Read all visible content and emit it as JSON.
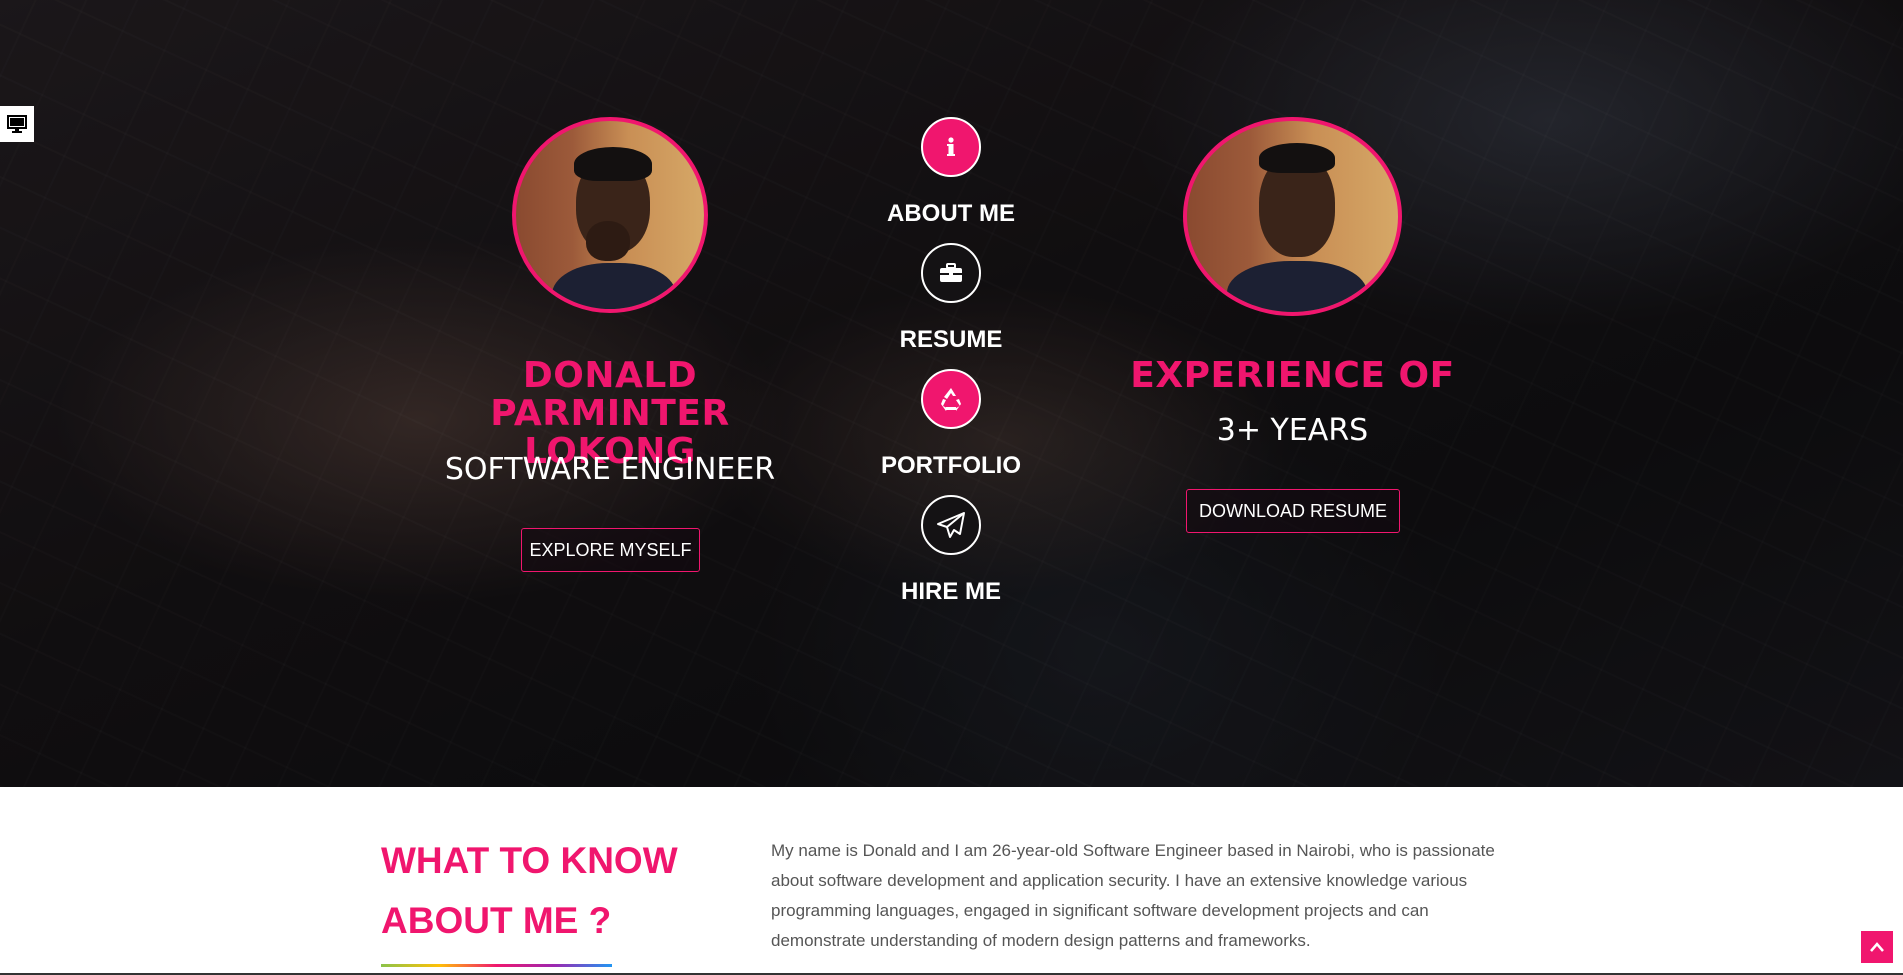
{
  "hero": {
    "name": "DONALD PARMINTER LOKONG",
    "role": "SOFTWARE ENGINEER",
    "explore_label": "EXPLORE MYSELF",
    "experience_title": "EXPERIENCE OF",
    "experience_years": "3+ YEARS",
    "download_label": "DOWNLOAD RESUME"
  },
  "nav": {
    "items": [
      {
        "label": "ABOUT ME",
        "icon": "info-icon"
      },
      {
        "label": "RESUME",
        "icon": "briefcase-icon"
      },
      {
        "label": "PORTFOLIO",
        "icon": "recycle-icon"
      },
      {
        "label": "HIRE ME",
        "icon": "paper-plane-icon"
      }
    ]
  },
  "about": {
    "title_line1": "WHAT TO KNOW",
    "title_line2": "ABOUT ME ?",
    "text": "My name is Donald and I am 26-year-old Software Engineer based in Nairobi, who is passionate about software development and application security. I have an extensive knowledge various programming languages, engaged in significant software development projects and can demonstrate understanding of modern design patterns and frameworks."
  },
  "colors": {
    "accent": "#f0166e",
    "text_muted": "#555555"
  }
}
